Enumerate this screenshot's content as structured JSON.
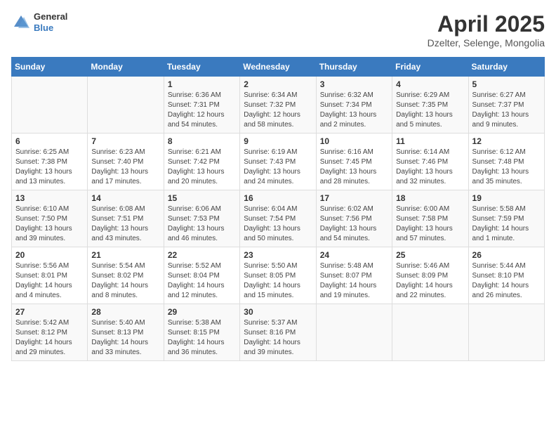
{
  "header": {
    "logo_line1": "General",
    "logo_line2": "Blue",
    "title": "April 2025",
    "subtitle": "Dzelter, Selenge, Mongolia"
  },
  "calendar": {
    "weekdays": [
      "Sunday",
      "Monday",
      "Tuesday",
      "Wednesday",
      "Thursday",
      "Friday",
      "Saturday"
    ],
    "weeks": [
      [
        {
          "day": "",
          "info": ""
        },
        {
          "day": "",
          "info": ""
        },
        {
          "day": "1",
          "info": "Sunrise: 6:36 AM\nSunset: 7:31 PM\nDaylight: 12 hours\nand 54 minutes."
        },
        {
          "day": "2",
          "info": "Sunrise: 6:34 AM\nSunset: 7:32 PM\nDaylight: 12 hours\nand 58 minutes."
        },
        {
          "day": "3",
          "info": "Sunrise: 6:32 AM\nSunset: 7:34 PM\nDaylight: 13 hours\nand 2 minutes."
        },
        {
          "day": "4",
          "info": "Sunrise: 6:29 AM\nSunset: 7:35 PM\nDaylight: 13 hours\nand 5 minutes."
        },
        {
          "day": "5",
          "info": "Sunrise: 6:27 AM\nSunset: 7:37 PM\nDaylight: 13 hours\nand 9 minutes."
        }
      ],
      [
        {
          "day": "6",
          "info": "Sunrise: 6:25 AM\nSunset: 7:38 PM\nDaylight: 13 hours\nand 13 minutes."
        },
        {
          "day": "7",
          "info": "Sunrise: 6:23 AM\nSunset: 7:40 PM\nDaylight: 13 hours\nand 17 minutes."
        },
        {
          "day": "8",
          "info": "Sunrise: 6:21 AM\nSunset: 7:42 PM\nDaylight: 13 hours\nand 20 minutes."
        },
        {
          "day": "9",
          "info": "Sunrise: 6:19 AM\nSunset: 7:43 PM\nDaylight: 13 hours\nand 24 minutes."
        },
        {
          "day": "10",
          "info": "Sunrise: 6:16 AM\nSunset: 7:45 PM\nDaylight: 13 hours\nand 28 minutes."
        },
        {
          "day": "11",
          "info": "Sunrise: 6:14 AM\nSunset: 7:46 PM\nDaylight: 13 hours\nand 32 minutes."
        },
        {
          "day": "12",
          "info": "Sunrise: 6:12 AM\nSunset: 7:48 PM\nDaylight: 13 hours\nand 35 minutes."
        }
      ],
      [
        {
          "day": "13",
          "info": "Sunrise: 6:10 AM\nSunset: 7:50 PM\nDaylight: 13 hours\nand 39 minutes."
        },
        {
          "day": "14",
          "info": "Sunrise: 6:08 AM\nSunset: 7:51 PM\nDaylight: 13 hours\nand 43 minutes."
        },
        {
          "day": "15",
          "info": "Sunrise: 6:06 AM\nSunset: 7:53 PM\nDaylight: 13 hours\nand 46 minutes."
        },
        {
          "day": "16",
          "info": "Sunrise: 6:04 AM\nSunset: 7:54 PM\nDaylight: 13 hours\nand 50 minutes."
        },
        {
          "day": "17",
          "info": "Sunrise: 6:02 AM\nSunset: 7:56 PM\nDaylight: 13 hours\nand 54 minutes."
        },
        {
          "day": "18",
          "info": "Sunrise: 6:00 AM\nSunset: 7:58 PM\nDaylight: 13 hours\nand 57 minutes."
        },
        {
          "day": "19",
          "info": "Sunrise: 5:58 AM\nSunset: 7:59 PM\nDaylight: 14 hours\nand 1 minute."
        }
      ],
      [
        {
          "day": "20",
          "info": "Sunrise: 5:56 AM\nSunset: 8:01 PM\nDaylight: 14 hours\nand 4 minutes."
        },
        {
          "day": "21",
          "info": "Sunrise: 5:54 AM\nSunset: 8:02 PM\nDaylight: 14 hours\nand 8 minutes."
        },
        {
          "day": "22",
          "info": "Sunrise: 5:52 AM\nSunset: 8:04 PM\nDaylight: 14 hours\nand 12 minutes."
        },
        {
          "day": "23",
          "info": "Sunrise: 5:50 AM\nSunset: 8:05 PM\nDaylight: 14 hours\nand 15 minutes."
        },
        {
          "day": "24",
          "info": "Sunrise: 5:48 AM\nSunset: 8:07 PM\nDaylight: 14 hours\nand 19 minutes."
        },
        {
          "day": "25",
          "info": "Sunrise: 5:46 AM\nSunset: 8:09 PM\nDaylight: 14 hours\nand 22 minutes."
        },
        {
          "day": "26",
          "info": "Sunrise: 5:44 AM\nSunset: 8:10 PM\nDaylight: 14 hours\nand 26 minutes."
        }
      ],
      [
        {
          "day": "27",
          "info": "Sunrise: 5:42 AM\nSunset: 8:12 PM\nDaylight: 14 hours\nand 29 minutes."
        },
        {
          "day": "28",
          "info": "Sunrise: 5:40 AM\nSunset: 8:13 PM\nDaylight: 14 hours\nand 33 minutes."
        },
        {
          "day": "29",
          "info": "Sunrise: 5:38 AM\nSunset: 8:15 PM\nDaylight: 14 hours\nand 36 minutes."
        },
        {
          "day": "30",
          "info": "Sunrise: 5:37 AM\nSunset: 8:16 PM\nDaylight: 14 hours\nand 39 minutes."
        },
        {
          "day": "",
          "info": ""
        },
        {
          "day": "",
          "info": ""
        },
        {
          "day": "",
          "info": ""
        }
      ]
    ]
  }
}
